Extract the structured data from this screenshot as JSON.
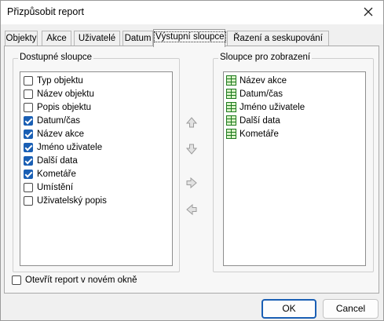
{
  "window": {
    "title": "Přizpůsobit report"
  },
  "tabs": [
    {
      "label": "Objekty"
    },
    {
      "label": "Akce"
    },
    {
      "label": "Uživatelé"
    },
    {
      "label": "Datum"
    },
    {
      "label": "Výstupní sloupce",
      "active": true
    },
    {
      "label": "Řazení a seskupování"
    }
  ],
  "available_columns": {
    "label": "Dostupné sloupce",
    "items": [
      {
        "label": "Typ objektu",
        "checked": false
      },
      {
        "label": "Název objektu",
        "checked": false
      },
      {
        "label": "Popis objektu",
        "checked": false
      },
      {
        "label": "Datum/čas",
        "checked": true
      },
      {
        "label": "Název akce",
        "checked": true
      },
      {
        "label": "Jméno uživatele",
        "checked": true
      },
      {
        "label": "Další data",
        "checked": true
      },
      {
        "label": "Kometáře",
        "checked": true
      },
      {
        "label": "Umístění",
        "checked": false
      },
      {
        "label": "Uživatelský popis",
        "checked": false
      }
    ]
  },
  "display_columns": {
    "label": "Sloupce pro zobrazení",
    "items": [
      {
        "label": "Název akce"
      },
      {
        "label": "Datum/čas"
      },
      {
        "label": "Jméno uživatele"
      },
      {
        "label": "Další data"
      },
      {
        "label": "Kometáře"
      }
    ]
  },
  "move_buttons": [
    "arrow-up-icon",
    "arrow-down-icon",
    "arrow-right-icon",
    "arrow-left-icon"
  ],
  "open_in_new_window": {
    "label": "Otevřít report v novém okně",
    "checked": false
  },
  "footer": {
    "ok_label": "OK",
    "cancel_label": "Cancel"
  },
  "colors": {
    "accent": "#1a5fb4",
    "grid_icon": "#1d7a1d"
  }
}
